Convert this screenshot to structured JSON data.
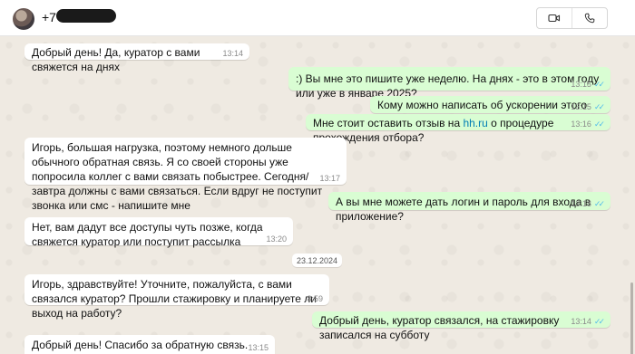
{
  "header": {
    "contact_name": "+7",
    "video_call_icon": "video-camera-icon",
    "voice_call_icon": "phone-icon"
  },
  "messages": [
    {
      "direction": "in",
      "text": "Добрый день! Да, куратор с вами свяжется на днях",
      "time": "13:14"
    },
    {
      "direction": "out",
      "text": ":) Вы мне это пишите уже неделю. На днях - это в этом году или уже в январе 2025?",
      "time": "13:15",
      "status": "read"
    },
    {
      "direction": "out",
      "text": "Кому можно написать об ускорении этого процесса?",
      "time": "13:15",
      "status": "read"
    },
    {
      "direction": "out",
      "text_before": "Мне стоит оставить отзыв на ",
      "link": "hh.ru",
      "text_after": " о процедуре прохождения отбора?",
      "time": "13:16",
      "status": "read"
    },
    {
      "direction": "in",
      "text": "Игорь, большая нагрузка, поэтому немного дольше обычного обратная связь. Я со своей стороны уже попросила коллег с вами связать побыстрее. Сегодня/завтра должны с вами связаться. Если вдруг не поступит звонка или смс - напишите мне",
      "time": "13:17"
    },
    {
      "direction": "out",
      "text": "А вы мне можете дать логин и пароль для входа в приложение?",
      "time": "13:18",
      "status": "read"
    },
    {
      "direction": "in",
      "text": "Нет, вам дадут все доступы чуть  позже, когда свяжется куратор или поступит рассылка",
      "time": "13:20"
    },
    {
      "direction": "in",
      "text": "Игорь, здравствуйте! Уточните, пожалуйста, с вами связался куратор? Прошли стажировку и планируете ли выход на работу?",
      "time": "8:59"
    },
    {
      "direction": "out",
      "text": "Добрый день, куратор связался, на стажировку записался на субботу",
      "time": "13:14",
      "status": "read"
    },
    {
      "direction": "in",
      "text": "Добрый день! Спасибо за обратную связь. Хорошего дня!",
      "time": "13:15"
    }
  ],
  "date_separator": "23.12.2024",
  "colors": {
    "incoming_bubble": "#ffffff",
    "outgoing_bubble": "#d9fdd3",
    "read_ticks": "#53bdeb",
    "chat_background": "#efeae2",
    "link": "#027eb5"
  }
}
